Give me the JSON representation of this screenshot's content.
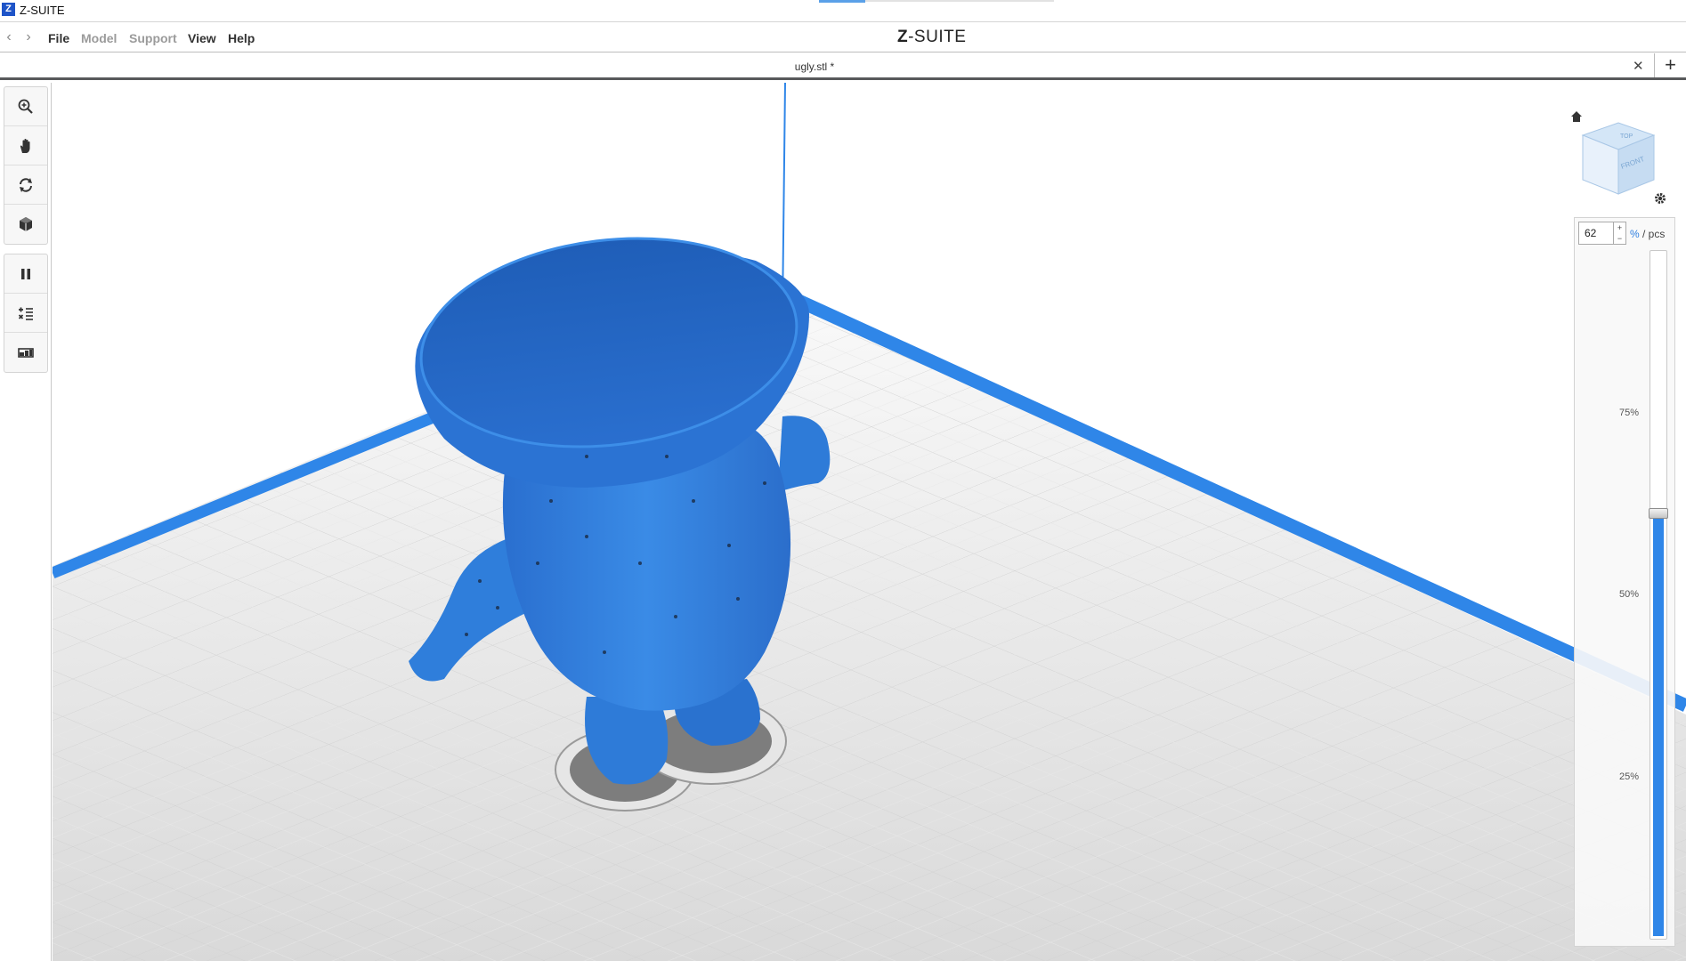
{
  "window": {
    "app_logo": "Z",
    "title": "Z-SUITE"
  },
  "menubar": {
    "back_arrow": "‹",
    "forward_arrow": "›",
    "items": [
      {
        "label": "File",
        "enabled": true
      },
      {
        "label": "Model",
        "enabled": false
      },
      {
        "label": "Support",
        "enabled": false
      },
      {
        "label": "View",
        "enabled": true
      },
      {
        "label": "Help",
        "enabled": true
      }
    ],
    "brand_z": "Z",
    "brand_rest": "-SUITE"
  },
  "tab": {
    "title": "ugly.stl *",
    "close": "✕",
    "add": "+"
  },
  "toolbar": {
    "group1": [
      "zoom-icon",
      "pan-hand-icon",
      "rotate-icon",
      "view-cube-icon"
    ],
    "group2": [
      "pause-icon",
      "layer-list-icon",
      "layer-view-icon"
    ]
  },
  "view_cube": {
    "top_label": "TOP",
    "front_label": "FRONT"
  },
  "layer_slider": {
    "value": "62",
    "spin_up": "+",
    "spin_down": "−",
    "unit_pct": "%",
    "unit_rest": " / pcs",
    "level_fraction": 0.62,
    "ticks": [
      "75%",
      "50%",
      "25%"
    ]
  },
  "colors": {
    "model": "#2e7bd8",
    "platform_edge": "#2f86e8",
    "accent": "#2f86e8"
  }
}
